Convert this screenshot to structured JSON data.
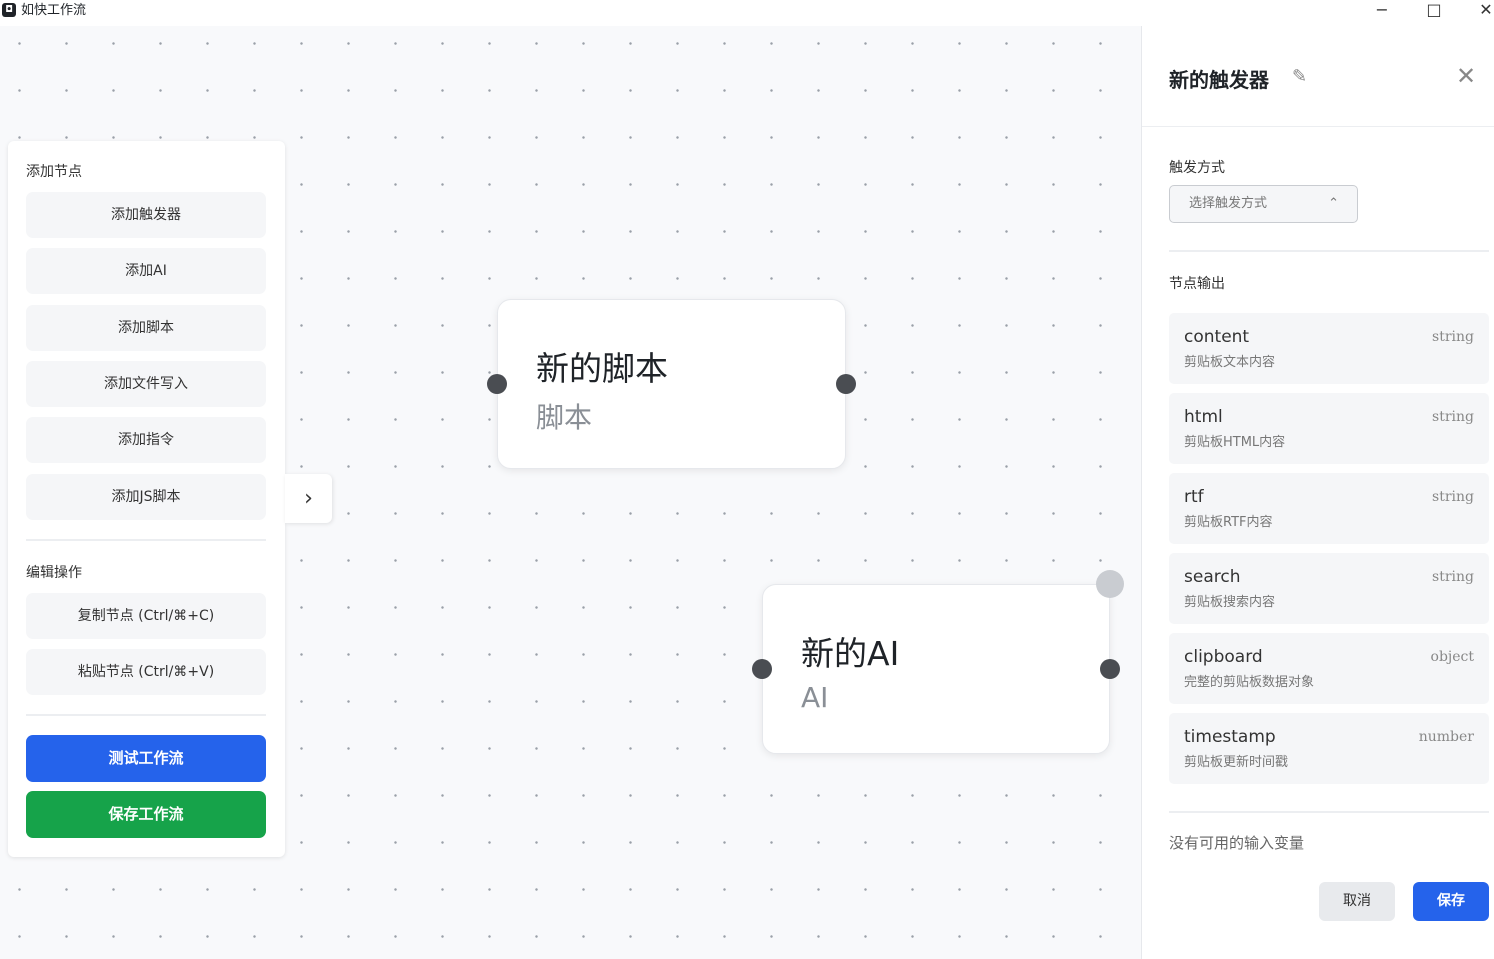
{
  "window": {
    "app_icon": "workflow-app-icon",
    "title": "如快工作流",
    "minimize": "−",
    "maximize": "□",
    "close": "✕"
  },
  "toolbox": {
    "add_section_title": "添加节点",
    "add_buttons": [
      "添加触发器",
      "添加AI",
      "添加脚本",
      "添加文件写入",
      "添加指令",
      "添加JS脚本"
    ],
    "edit_section_title": "编辑操作",
    "edit_buttons": [
      "复制节点 (Ctrl/⌘+C)",
      "粘贴节点 (Ctrl/⌘+V)"
    ],
    "test_label": "测试工作流",
    "save_label": "保存工作流",
    "expand_icon": "›"
  },
  "nodes": [
    {
      "title": "新的脚本",
      "type": "脚本"
    },
    {
      "title": "新的AI",
      "type": "AI"
    }
  ],
  "panel": {
    "title": "新的触发器",
    "trigger_label": "触发方式",
    "trigger_placeholder": "选择触发方式",
    "outputs_label": "节点输出",
    "outputs": [
      {
        "name": "content",
        "desc": "剪贴板文本内容",
        "type": "string"
      },
      {
        "name": "html",
        "desc": "剪贴板HTML内容",
        "type": "string"
      },
      {
        "name": "rtf",
        "desc": "剪贴板RTF内容",
        "type": "string"
      },
      {
        "name": "search",
        "desc": "剪贴板搜索内容",
        "type": "string"
      },
      {
        "name": "clipboard",
        "desc": "完整的剪贴板数据对象",
        "type": "object"
      },
      {
        "name": "timestamp",
        "desc": "剪贴板更新时间戳",
        "type": "number"
      }
    ],
    "empty_inputs": "没有可用的输入变量",
    "cancel_label": "取消",
    "save_label": "保存"
  },
  "colors": {
    "primary": "#2563eb",
    "success": "#16a34a"
  }
}
